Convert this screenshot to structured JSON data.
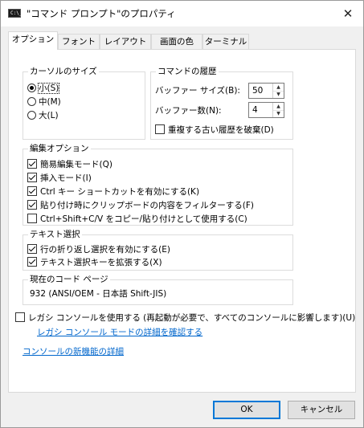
{
  "window": {
    "title": "\"コマンド プロンプト\"のプロパティ",
    "icon": "cmd-console-icon",
    "close_glyph": "✕"
  },
  "tabs": [
    {
      "label": "オプション",
      "active": true
    },
    {
      "label": "フォント",
      "active": false
    },
    {
      "label": "レイアウト",
      "active": false
    },
    {
      "label": "画面の色",
      "active": false
    },
    {
      "label": "ターミナル",
      "active": false
    }
  ],
  "cursor_size": {
    "title": "カーソルのサイズ",
    "options": [
      {
        "label": "小(S)",
        "checked": true
      },
      {
        "label": "中(M)",
        "checked": false
      },
      {
        "label": "大(L)",
        "checked": false
      }
    ]
  },
  "history": {
    "title": "コマンドの履歴",
    "buffer_size_label": "バッファー サイズ(B):",
    "buffer_size_value": "50",
    "buffer_count_label": "バッファー数(N):",
    "buffer_count_value": "4",
    "discard_duplicates_label": "重複する古い履歴を破棄(D)",
    "discard_duplicates_checked": false
  },
  "edit_options": {
    "title": "編集オプション",
    "items": [
      {
        "label": "簡易編集モード(Q)",
        "checked": true
      },
      {
        "label": "挿入モード(I)",
        "checked": true
      },
      {
        "label": "Ctrl キー ショートカットを有効にする(K)",
        "checked": true
      },
      {
        "label": "貼り付け時にクリップボードの内容をフィルターする(F)",
        "checked": true
      },
      {
        "label": "Ctrl+Shift+C/V をコピー/貼り付けとして使用する(C)",
        "checked": false
      }
    ]
  },
  "text_selection": {
    "title": "テキスト選択",
    "items": [
      {
        "label": "行の折り返し選択を有効にする(E)",
        "checked": true
      },
      {
        "label": "テキスト選択キーを拡張する(X)",
        "checked": true
      }
    ]
  },
  "code_page": {
    "title": "現在のコード ページ",
    "value": "932   (ANSI/OEM - 日本語 Shift-JIS)"
  },
  "legacy": {
    "label": "レガシ コンソールを使用する (再起動が必要で、すべてのコンソールに影響します)(U)",
    "checked": false,
    "details_link": "レガシ コンソール モードの詳細を確認する"
  },
  "new_features_link": "コンソールの新機能の詳細",
  "buttons": {
    "ok": "OK",
    "cancel": "キャンセル"
  },
  "colors": {
    "accent": "#0078d7",
    "link": "#0066cc",
    "panel": "#ffffff",
    "chrome": "#f0f0f0"
  }
}
